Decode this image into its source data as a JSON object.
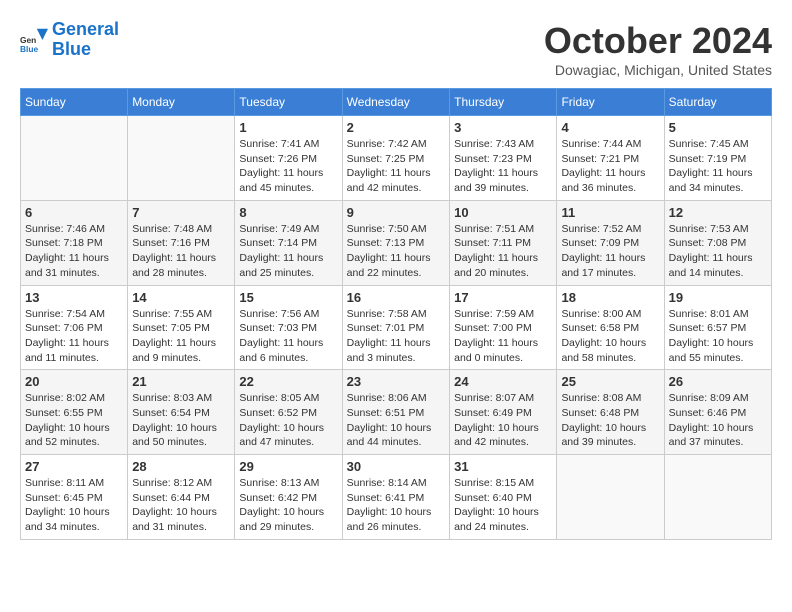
{
  "logo": {
    "line1": "General",
    "line2": "Blue"
  },
  "title": "October 2024",
  "location": "Dowagiac, Michigan, United States",
  "weekdays": [
    "Sunday",
    "Monday",
    "Tuesday",
    "Wednesday",
    "Thursday",
    "Friday",
    "Saturday"
  ],
  "weeks": [
    [
      {
        "day": "",
        "info": ""
      },
      {
        "day": "",
        "info": ""
      },
      {
        "day": "1",
        "info": "Sunrise: 7:41 AM\nSunset: 7:26 PM\nDaylight: 11 hours and 45 minutes."
      },
      {
        "day": "2",
        "info": "Sunrise: 7:42 AM\nSunset: 7:25 PM\nDaylight: 11 hours and 42 minutes."
      },
      {
        "day": "3",
        "info": "Sunrise: 7:43 AM\nSunset: 7:23 PM\nDaylight: 11 hours and 39 minutes."
      },
      {
        "day": "4",
        "info": "Sunrise: 7:44 AM\nSunset: 7:21 PM\nDaylight: 11 hours and 36 minutes."
      },
      {
        "day": "5",
        "info": "Sunrise: 7:45 AM\nSunset: 7:19 PM\nDaylight: 11 hours and 34 minutes."
      }
    ],
    [
      {
        "day": "6",
        "info": "Sunrise: 7:46 AM\nSunset: 7:18 PM\nDaylight: 11 hours and 31 minutes."
      },
      {
        "day": "7",
        "info": "Sunrise: 7:48 AM\nSunset: 7:16 PM\nDaylight: 11 hours and 28 minutes."
      },
      {
        "day": "8",
        "info": "Sunrise: 7:49 AM\nSunset: 7:14 PM\nDaylight: 11 hours and 25 minutes."
      },
      {
        "day": "9",
        "info": "Sunrise: 7:50 AM\nSunset: 7:13 PM\nDaylight: 11 hours and 22 minutes."
      },
      {
        "day": "10",
        "info": "Sunrise: 7:51 AM\nSunset: 7:11 PM\nDaylight: 11 hours and 20 minutes."
      },
      {
        "day": "11",
        "info": "Sunrise: 7:52 AM\nSunset: 7:09 PM\nDaylight: 11 hours and 17 minutes."
      },
      {
        "day": "12",
        "info": "Sunrise: 7:53 AM\nSunset: 7:08 PM\nDaylight: 11 hours and 14 minutes."
      }
    ],
    [
      {
        "day": "13",
        "info": "Sunrise: 7:54 AM\nSunset: 7:06 PM\nDaylight: 11 hours and 11 minutes."
      },
      {
        "day": "14",
        "info": "Sunrise: 7:55 AM\nSunset: 7:05 PM\nDaylight: 11 hours and 9 minutes."
      },
      {
        "day": "15",
        "info": "Sunrise: 7:56 AM\nSunset: 7:03 PM\nDaylight: 11 hours and 6 minutes."
      },
      {
        "day": "16",
        "info": "Sunrise: 7:58 AM\nSunset: 7:01 PM\nDaylight: 11 hours and 3 minutes."
      },
      {
        "day": "17",
        "info": "Sunrise: 7:59 AM\nSunset: 7:00 PM\nDaylight: 11 hours and 0 minutes."
      },
      {
        "day": "18",
        "info": "Sunrise: 8:00 AM\nSunset: 6:58 PM\nDaylight: 10 hours and 58 minutes."
      },
      {
        "day": "19",
        "info": "Sunrise: 8:01 AM\nSunset: 6:57 PM\nDaylight: 10 hours and 55 minutes."
      }
    ],
    [
      {
        "day": "20",
        "info": "Sunrise: 8:02 AM\nSunset: 6:55 PM\nDaylight: 10 hours and 52 minutes."
      },
      {
        "day": "21",
        "info": "Sunrise: 8:03 AM\nSunset: 6:54 PM\nDaylight: 10 hours and 50 minutes."
      },
      {
        "day": "22",
        "info": "Sunrise: 8:05 AM\nSunset: 6:52 PM\nDaylight: 10 hours and 47 minutes."
      },
      {
        "day": "23",
        "info": "Sunrise: 8:06 AM\nSunset: 6:51 PM\nDaylight: 10 hours and 44 minutes."
      },
      {
        "day": "24",
        "info": "Sunrise: 8:07 AM\nSunset: 6:49 PM\nDaylight: 10 hours and 42 minutes."
      },
      {
        "day": "25",
        "info": "Sunrise: 8:08 AM\nSunset: 6:48 PM\nDaylight: 10 hours and 39 minutes."
      },
      {
        "day": "26",
        "info": "Sunrise: 8:09 AM\nSunset: 6:46 PM\nDaylight: 10 hours and 37 minutes."
      }
    ],
    [
      {
        "day": "27",
        "info": "Sunrise: 8:11 AM\nSunset: 6:45 PM\nDaylight: 10 hours and 34 minutes."
      },
      {
        "day": "28",
        "info": "Sunrise: 8:12 AM\nSunset: 6:44 PM\nDaylight: 10 hours and 31 minutes."
      },
      {
        "day": "29",
        "info": "Sunrise: 8:13 AM\nSunset: 6:42 PM\nDaylight: 10 hours and 29 minutes."
      },
      {
        "day": "30",
        "info": "Sunrise: 8:14 AM\nSunset: 6:41 PM\nDaylight: 10 hours and 26 minutes."
      },
      {
        "day": "31",
        "info": "Sunrise: 8:15 AM\nSunset: 6:40 PM\nDaylight: 10 hours and 24 minutes."
      },
      {
        "day": "",
        "info": ""
      },
      {
        "day": "",
        "info": ""
      }
    ]
  ]
}
